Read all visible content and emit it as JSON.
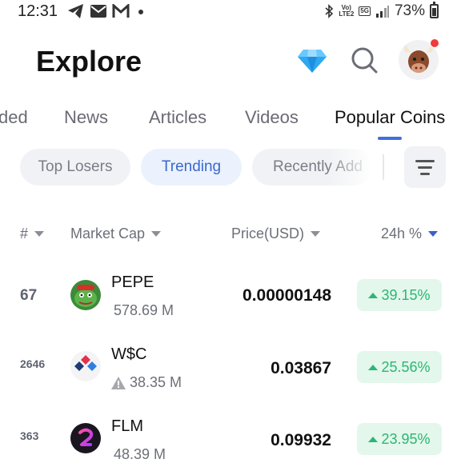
{
  "status_bar": {
    "time": "12:31",
    "network_top": "Vo)",
    "network_bottom": "LTE2",
    "network_gen": "5G",
    "battery": "73%"
  },
  "header": {
    "title": "Explore"
  },
  "tabs": [
    {
      "label": "ded"
    },
    {
      "label": "News"
    },
    {
      "label": "Articles"
    },
    {
      "label": "Videos"
    },
    {
      "label": "Popular Coins",
      "active": true
    }
  ],
  "filters": [
    {
      "label": "Top Losers"
    },
    {
      "label": "Trending",
      "active": true
    },
    {
      "label": "Recently Add"
    }
  ],
  "columns": {
    "rank": "#",
    "market_cap": "Market Cap",
    "price": "Price(USD)",
    "change": "24h %"
  },
  "rows": [
    {
      "rank": "67",
      "name": "PEPE",
      "market_cap": "578.69 M",
      "price": "0.00000148",
      "change": "39.15%",
      "warning": false
    },
    {
      "rank": "2646",
      "name": "W$C",
      "market_cap": "38.35 M",
      "price": "0.03867",
      "change": "25.56%",
      "warning": true
    },
    {
      "rank": "363",
      "name": "FLM",
      "market_cap": "48.39 M",
      "price": "0.09932",
      "change": "23.95%",
      "warning": false
    }
  ],
  "colors": {
    "accent": "#3a68cf",
    "positive": "#2bb673",
    "positive_bg": "#e3f7ec"
  },
  "icons": [
    "telegram-icon",
    "mail-icon",
    "gmail-icon",
    "bluetooth-icon",
    "signal-icon",
    "battery-icon",
    "diamond-icon",
    "search-icon",
    "avatar-icon",
    "filter-icon",
    "sort-caret-icon",
    "warning-icon"
  ]
}
